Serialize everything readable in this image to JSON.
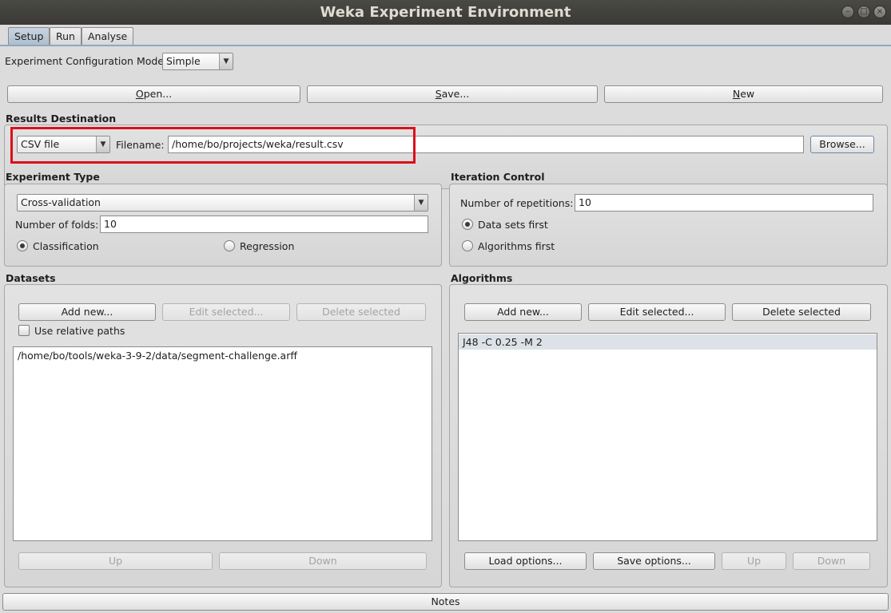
{
  "window": {
    "title": "Weka Experiment Environment"
  },
  "tabs": [
    {
      "label": "Setup",
      "active": true
    },
    {
      "label": "Run",
      "active": false
    },
    {
      "label": "Analyse",
      "active": false
    }
  ],
  "config_mode": {
    "label": "Experiment Configuration Mode",
    "value": "Simple"
  },
  "toolbar": {
    "open_pre": "",
    "open_u": "O",
    "open_post": "pen...",
    "save_pre": "",
    "save_u": "S",
    "save_post": "ave...",
    "new_pre": "",
    "new_u": "N",
    "new_post": "ew"
  },
  "results_destination": {
    "title": "Results Destination",
    "type_value": "CSV file",
    "filename_label": "Filename:",
    "filename_value": "/home/bo/projects/weka/result.csv",
    "browse_label": "Browse...",
    "highlight_color": "#d9111b"
  },
  "experiment_type": {
    "title": "Experiment Type",
    "type_value": "Cross-validation",
    "folds_label": "Number of folds:",
    "folds_value": "10",
    "classification_label": "Classification",
    "regression_label": "Regression",
    "selected": "Classification"
  },
  "iteration_control": {
    "title": "Iteration Control",
    "repetitions_label": "Number of repetitions:",
    "repetitions_value": "10",
    "datasets_first_label": "Data sets first",
    "algorithms_first_label": "Algorithms first",
    "selected": "Data sets first"
  },
  "datasets": {
    "title": "Datasets",
    "add_label": "Add new...",
    "edit_label": "Edit selected...",
    "delete_label": "Delete selected",
    "relative_paths_label": "Use relative paths",
    "relative_paths_checked": false,
    "items": [
      "/home/bo/tools/weka-3-9-2/data/segment-challenge.arff"
    ],
    "up_label": "Up",
    "down_label": "Down"
  },
  "algorithms": {
    "title": "Algorithms",
    "add_label": "Add new...",
    "edit_label": "Edit selected...",
    "delete_label": "Delete selected",
    "items": [
      "J48 -C 0.25 -M 2"
    ],
    "load_label": "Load options...",
    "save_label": "Save options...",
    "up_label": "Up",
    "down_label": "Down"
  },
  "notes": {
    "label": "Notes"
  }
}
